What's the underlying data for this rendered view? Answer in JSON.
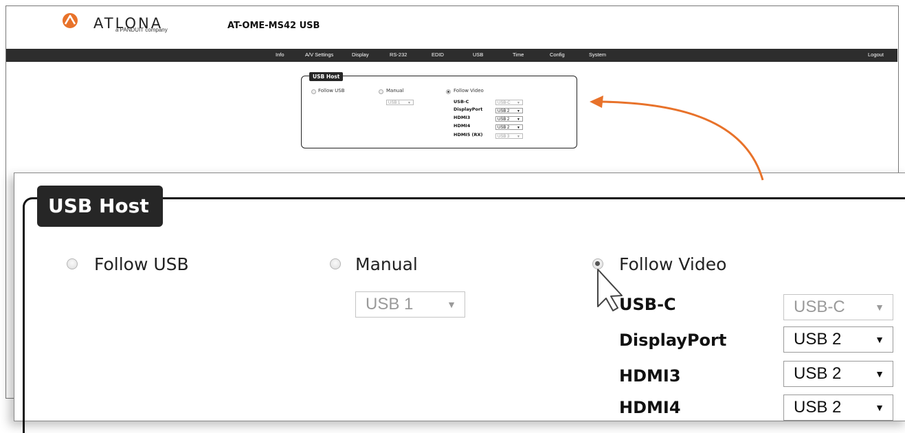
{
  "header": {
    "brand": "ATLONA",
    "brand_sub": "a PANDUIT company",
    "title": "AT-OME-MS42  USB"
  },
  "nav": {
    "items": [
      "Info",
      "A/V Settings",
      "Display",
      "RS-232",
      "EDID",
      "USB",
      "Time",
      "Config",
      "System"
    ],
    "logout": "Logout"
  },
  "usb_host": {
    "legend": "USB Host",
    "options": [
      "Follow USB",
      "Manual",
      "Follow Video"
    ],
    "selected_option": "Follow Video",
    "manual_select": "USB 1",
    "ports": [
      {
        "label": "USB-C",
        "value": "USB-C",
        "disabled": true
      },
      {
        "label": "DisplayPort",
        "value": "USB 2",
        "disabled": false
      },
      {
        "label": "HDMI3",
        "value": "USB 2",
        "disabled": false
      },
      {
        "label": "HDMI4",
        "value": "USB 2",
        "disabled": false
      },
      {
        "label": "HDMI5 (RX)",
        "value": "USB 3",
        "disabled": true
      }
    ]
  },
  "zoom": {
    "legend": "USB Host",
    "opt_follow_usb": "Follow USB",
    "opt_manual": "Manual",
    "opt_follow_video": "Follow Video",
    "manual_select": "USB 1",
    "port1_label": "USB-C",
    "port1_value": "USB-C",
    "port2_label": "DisplayPort",
    "port2_value": "USB 2",
    "port3_label": "HDMI3",
    "port3_value": "USB 2",
    "port4_label": "HDMI4",
    "port4_value": "USB 2"
  },
  "colors": {
    "accent_orange": "#e8722a",
    "navbar": "#2d2d2d",
    "legend_bg": "#262626"
  },
  "icons": {
    "logo": "atlona-logo-icon",
    "cursor": "mouse-pointer-icon",
    "arrow": "callout-arrow-icon",
    "dropdown": "caret-down-icon"
  }
}
